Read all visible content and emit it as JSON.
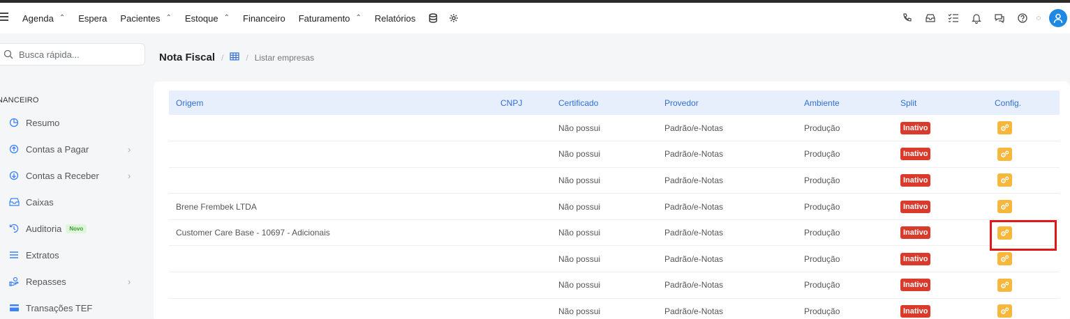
{
  "topnav": {
    "items": [
      {
        "label": "Agenda",
        "dropdown": true
      },
      {
        "label": "Espera",
        "dropdown": false
      },
      {
        "label": "Pacientes",
        "dropdown": true
      },
      {
        "label": "Estoque",
        "dropdown": true
      },
      {
        "label": "Financeiro",
        "dropdown": false
      },
      {
        "label": "Faturamento",
        "dropdown": true
      },
      {
        "label": "Relatórios",
        "dropdown": false
      }
    ],
    "caret": "⌃",
    "icons_after_menu": [
      "database-icon",
      "settings-icon"
    ],
    "right_icons": [
      "phone-icon",
      "inbox-icon",
      "checklist-icon",
      "bell-icon",
      "chat-icon",
      "help-icon"
    ],
    "accent": "#1e88e5"
  },
  "search": {
    "placeholder": "Busca rápida..."
  },
  "sidebar": {
    "section": "NANCEIRO",
    "items": [
      {
        "label": "Resumo",
        "icon": "pie-chart-icon",
        "chevron": false,
        "badge": ""
      },
      {
        "label": "Contas a Pagar",
        "icon": "arrow-up-circle-icon",
        "chevron": true,
        "badge": ""
      },
      {
        "label": "Contas a Receber",
        "icon": "arrow-down-circle-icon",
        "chevron": true,
        "badge": ""
      },
      {
        "label": "Caixas",
        "icon": "inbox-icon",
        "chevron": false,
        "badge": ""
      },
      {
        "label": "Auditoria",
        "icon": "history-icon",
        "chevron": false,
        "badge": "Novo"
      },
      {
        "label": "Extratos",
        "icon": "list-icon",
        "chevron": false,
        "badge": ""
      },
      {
        "label": "Repasses",
        "icon": "hand-coin-icon",
        "chevron": true,
        "badge": ""
      },
      {
        "label": "Transações TEF",
        "icon": "card-icon",
        "chevron": false,
        "badge": ""
      }
    ]
  },
  "breadcrumb": {
    "title": "Nota Fiscal",
    "sep": "/",
    "current": "Listar empresas"
  },
  "table": {
    "columns": [
      "Origem",
      "CNPJ",
      "Certificado",
      "Provedor",
      "Ambiente",
      "Split",
      "Config."
    ],
    "rows": [
      {
        "origem": "",
        "cnpj": "",
        "certificado": "Não possui",
        "provedor": "Padrão/e-Notas",
        "ambiente": "Produção",
        "split": "Inativo"
      },
      {
        "origem": "",
        "cnpj": "",
        "certificado": "Não possui",
        "provedor": "Padrão/e-Notas",
        "ambiente": "Produção",
        "split": "Inativo"
      },
      {
        "origem": "",
        "cnpj": "",
        "certificado": "Não possui",
        "provedor": "Padrão/e-Notas",
        "ambiente": "Produção",
        "split": "Inativo"
      },
      {
        "origem": "Brene Frembek LTDA",
        "cnpj": "",
        "certificado": "Não possui",
        "provedor": "Padrão/e-Notas",
        "ambiente": "Produção",
        "split": "Inativo"
      },
      {
        "origem": "Customer Care Base - 10697 - Adicionais",
        "cnpj": "",
        "certificado": "Não possui",
        "provedor": "Padrão/e-Notas",
        "ambiente": "Produção",
        "split": "Inativo"
      },
      {
        "origem": "",
        "cnpj": "",
        "certificado": "Não possui",
        "provedor": "Padrão/e-Notas",
        "ambiente": "Produção",
        "split": "Inativo"
      },
      {
        "origem": "",
        "cnpj": "",
        "certificado": "Não possui",
        "provedor": "Padrão/e-Notas",
        "ambiente": "Produção",
        "split": "Inativo"
      },
      {
        "origem": "",
        "cnpj": "",
        "certificado": "Não possui",
        "provedor": "Padrão/e-Notas",
        "ambiente": "Produção",
        "split": "Inativo"
      }
    ],
    "config_icon": "gears-icon",
    "colors": {
      "header_bg": "#e7eefc",
      "header_text": "#2f6fd6",
      "inactive_badge": "#d93a2b",
      "config_button": "#f6b73c"
    }
  },
  "annotation": {
    "highlight_color": "#e01818"
  }
}
